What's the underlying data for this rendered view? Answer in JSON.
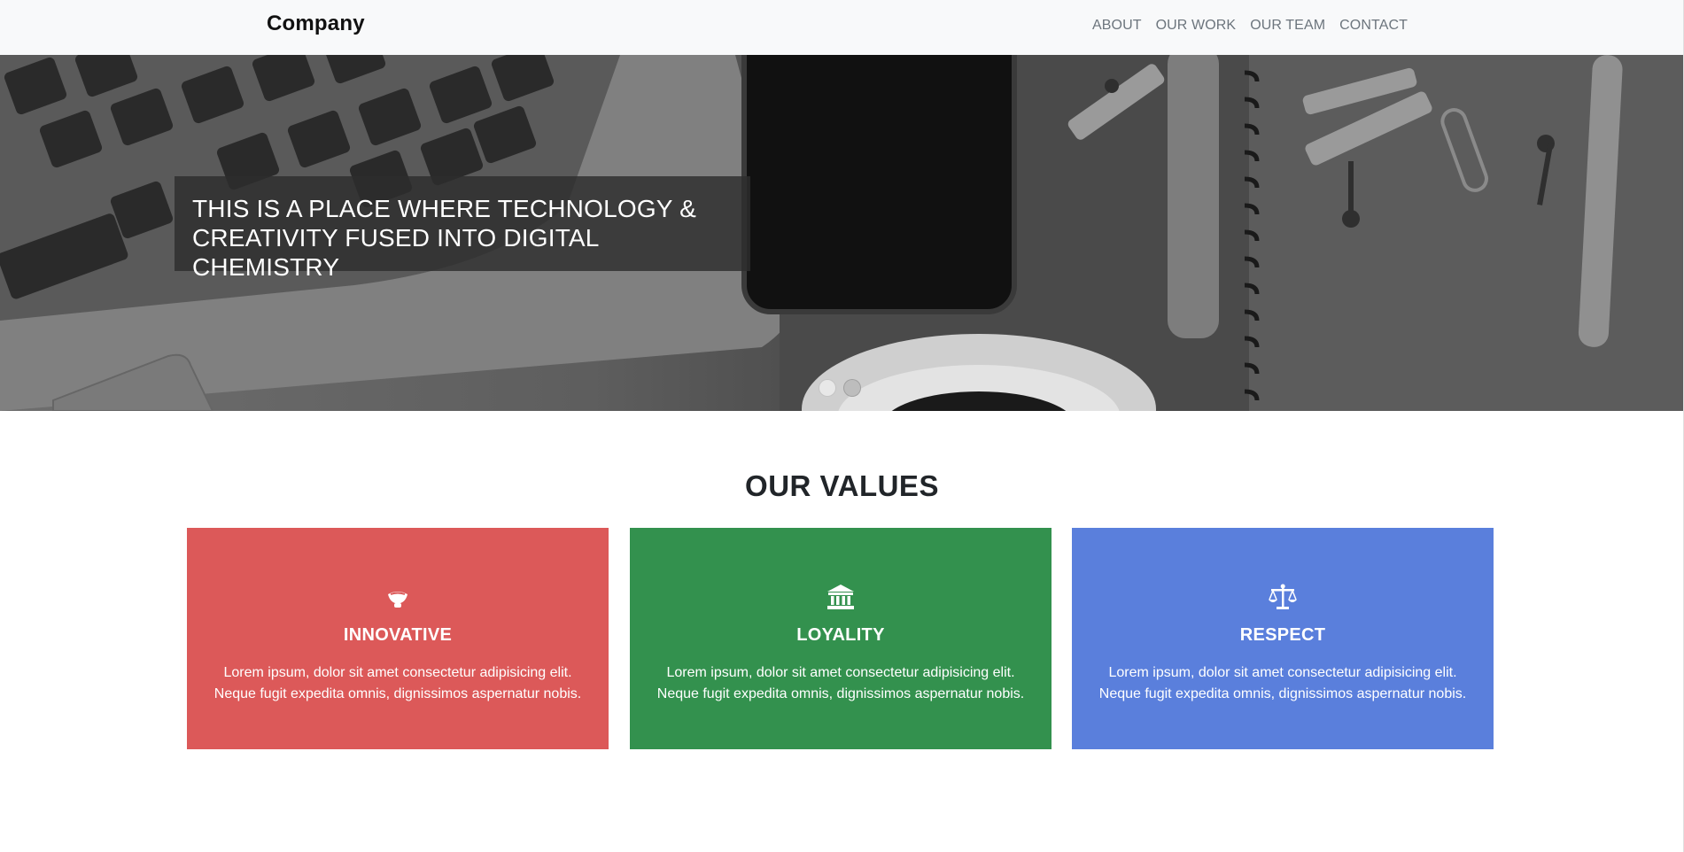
{
  "navbar": {
    "brand": "Company",
    "links": [
      "ABOUT",
      "OUR WORK",
      "OUR TEAM",
      "CONTACT"
    ]
  },
  "hero": {
    "caption": "THIS IS A PLACE WHERE TECHNOLOGY & CREATIVITY FUSED INTO DIGITAL CHEMISTRY",
    "slides_total": 2,
    "active_slide": 1
  },
  "values": {
    "title": "OUR VALUES",
    "cards": [
      {
        "icon": "lightbulb-icon",
        "title": "INNOVATIVE",
        "text": "Lorem ipsum, dolor sit amet consectetur adipisicing elit. Neque fugit expedita omnis, dignissimos aspernatur nobis.",
        "color": "#dc5959"
      },
      {
        "icon": "bank-icon",
        "title": "LOYALITY",
        "text": "Lorem ipsum, dolor sit amet consectetur adipisicing elit. Neque fugit expedita omnis, dignissimos aspernatur nobis.",
        "color": "#33914e"
      },
      {
        "icon": "balance-scale-icon",
        "title": "RESPECT",
        "text": "Lorem ipsum, dolor sit amet consectetur adipisicing elit. Neque fugit expedita omnis, dignissimos aspernatur nobis.",
        "color": "#5a7fdc"
      }
    ]
  }
}
